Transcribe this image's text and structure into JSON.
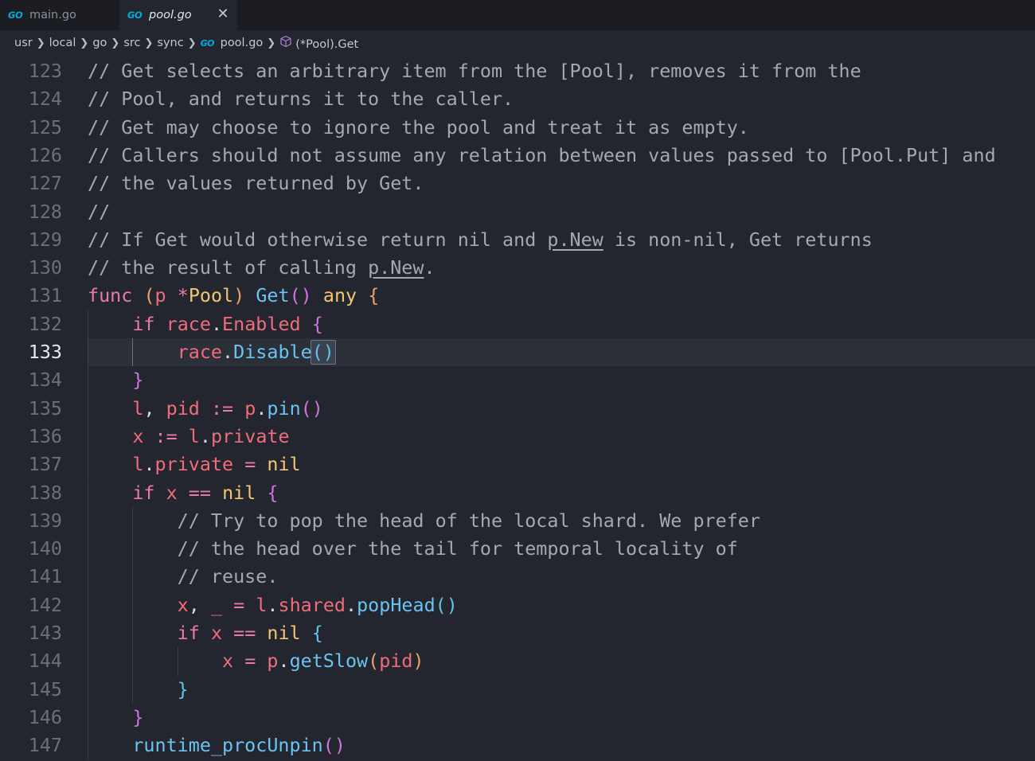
{
  "tabs": [
    {
      "label": "main.go",
      "icon": "go-file-icon",
      "active": false
    },
    {
      "label": "pool.go",
      "icon": "go-file-icon",
      "active": true
    }
  ],
  "tab_icon_text": "GO",
  "tab_close_glyph": "✕",
  "breadcrumb": [
    "usr",
    "local",
    "go",
    "src",
    "sync",
    "pool.go",
    "(*Pool).Get"
  ],
  "breadcrumb_separator": "❯",
  "current_line": 133,
  "colors": {
    "background": "#23262e",
    "tabbar": "#1b1d23",
    "comment": "#a3a8b2",
    "keyword": "#e87aa4",
    "function": "#6cc3f2",
    "variable": "#f06c7c",
    "type": "#f2c572"
  },
  "code_lines": [
    {
      "n": 123,
      "indent": 0,
      "tokens": [
        [
          "cm",
          "// Get selects an arbitrary item from the [Pool], removes it from the"
        ]
      ]
    },
    {
      "n": 124,
      "indent": 0,
      "tokens": [
        [
          "cm",
          "// Pool, and returns it to the caller."
        ]
      ]
    },
    {
      "n": 125,
      "indent": 0,
      "tokens": [
        [
          "cm",
          "// Get may choose to ignore the pool and treat it as empty."
        ]
      ]
    },
    {
      "n": 126,
      "indent": 0,
      "tokens": [
        [
          "cm",
          "// Callers should not assume any relation between values passed to [Pool.Put] and"
        ]
      ]
    },
    {
      "n": 127,
      "indent": 0,
      "tokens": [
        [
          "cm",
          "// the values returned by Get."
        ]
      ]
    },
    {
      "n": 128,
      "indent": 0,
      "tokens": [
        [
          "cm",
          "//"
        ]
      ]
    },
    {
      "n": 129,
      "indent": 0,
      "tokens": [
        [
          "cm",
          "// If Get would otherwise return nil and "
        ],
        [
          "cm ul",
          "p.New"
        ],
        [
          "cm",
          " is non-nil, Get returns"
        ]
      ]
    },
    {
      "n": 130,
      "indent": 0,
      "tokens": [
        [
          "cm",
          "// the result of calling "
        ],
        [
          "cm ul",
          "p.New"
        ],
        [
          "cm",
          "."
        ]
      ]
    },
    {
      "n": 131,
      "indent": 0,
      "tokens": [
        [
          "kw",
          "func"
        ],
        [
          "ps",
          " "
        ],
        [
          "b1",
          "("
        ],
        [
          "vr",
          "p"
        ],
        [
          "ps",
          " "
        ],
        [
          "op",
          "*"
        ],
        [
          "ty",
          "Pool"
        ],
        [
          "b1",
          ")"
        ],
        [
          "ps",
          " "
        ],
        [
          "fn",
          "Get"
        ],
        [
          "b2",
          "()"
        ],
        [
          "ps",
          " "
        ],
        [
          "ty",
          "any"
        ],
        [
          "ps",
          " "
        ],
        [
          "b1",
          "{"
        ]
      ]
    },
    {
      "n": 132,
      "indent": 1,
      "tokens": [
        [
          "kw",
          "if"
        ],
        [
          "ps",
          " "
        ],
        [
          "vr",
          "race"
        ],
        [
          "ps",
          "."
        ],
        [
          "vr",
          "Enabled"
        ],
        [
          "ps",
          " "
        ],
        [
          "b2",
          "{"
        ]
      ]
    },
    {
      "n": 133,
      "indent": 2,
      "tokens": [
        [
          "vr",
          "race"
        ],
        [
          "ps",
          "."
        ],
        [
          "fn",
          "Disable"
        ],
        [
          "b3",
          "()"
        ]
      ]
    },
    {
      "n": 134,
      "indent": 1,
      "tokens": [
        [
          "b2",
          "}"
        ]
      ]
    },
    {
      "n": 135,
      "indent": 1,
      "tokens": [
        [
          "vr",
          "l"
        ],
        [
          "ps",
          ", "
        ],
        [
          "vr",
          "pid"
        ],
        [
          "ps",
          " "
        ],
        [
          "op",
          ":="
        ],
        [
          "ps",
          " "
        ],
        [
          "vr",
          "p"
        ],
        [
          "ps",
          "."
        ],
        [
          "fn",
          "pin"
        ],
        [
          "b2",
          "()"
        ]
      ]
    },
    {
      "n": 136,
      "indent": 1,
      "tokens": [
        [
          "vr",
          "x"
        ],
        [
          "ps",
          " "
        ],
        [
          "op",
          ":="
        ],
        [
          "ps",
          " "
        ],
        [
          "vr",
          "l"
        ],
        [
          "ps",
          "."
        ],
        [
          "vr",
          "private"
        ]
      ]
    },
    {
      "n": 137,
      "indent": 1,
      "tokens": [
        [
          "vr",
          "l"
        ],
        [
          "ps",
          "."
        ],
        [
          "vr",
          "private"
        ],
        [
          "ps",
          " "
        ],
        [
          "op",
          "="
        ],
        [
          "ps",
          " "
        ],
        [
          "nl",
          "nil"
        ]
      ]
    },
    {
      "n": 138,
      "indent": 1,
      "tokens": [
        [
          "kw",
          "if"
        ],
        [
          "ps",
          " "
        ],
        [
          "vr",
          "x"
        ],
        [
          "ps",
          " "
        ],
        [
          "op",
          "=="
        ],
        [
          "ps",
          " "
        ],
        [
          "nl",
          "nil"
        ],
        [
          "ps",
          " "
        ],
        [
          "b2",
          "{"
        ]
      ]
    },
    {
      "n": 139,
      "indent": 2,
      "tokens": [
        [
          "cm",
          "// Try to pop the head of the local shard. We prefer"
        ]
      ]
    },
    {
      "n": 140,
      "indent": 2,
      "tokens": [
        [
          "cm",
          "// the head over the tail for temporal locality of"
        ]
      ]
    },
    {
      "n": 141,
      "indent": 2,
      "tokens": [
        [
          "cm",
          "// reuse."
        ]
      ]
    },
    {
      "n": 142,
      "indent": 2,
      "tokens": [
        [
          "vr",
          "x"
        ],
        [
          "ps",
          ", "
        ],
        [
          "vr",
          "_"
        ],
        [
          "ps",
          " "
        ],
        [
          "op",
          "="
        ],
        [
          "ps",
          " "
        ],
        [
          "vr",
          "l"
        ],
        [
          "ps",
          "."
        ],
        [
          "vr",
          "shared"
        ],
        [
          "ps",
          "."
        ],
        [
          "fn",
          "popHead"
        ],
        [
          "b3",
          "()"
        ]
      ]
    },
    {
      "n": 143,
      "indent": 2,
      "tokens": [
        [
          "kw",
          "if"
        ],
        [
          "ps",
          " "
        ],
        [
          "vr",
          "x"
        ],
        [
          "ps",
          " "
        ],
        [
          "op",
          "=="
        ],
        [
          "ps",
          " "
        ],
        [
          "nl",
          "nil"
        ],
        [
          "ps",
          " "
        ],
        [
          "b3",
          "{"
        ]
      ]
    },
    {
      "n": 144,
      "indent": 3,
      "tokens": [
        [
          "vr",
          "x"
        ],
        [
          "ps",
          " "
        ],
        [
          "op",
          "="
        ],
        [
          "ps",
          " "
        ],
        [
          "vr",
          "p"
        ],
        [
          "ps",
          "."
        ],
        [
          "fn",
          "getSlow"
        ],
        [
          "b1",
          "("
        ],
        [
          "vr",
          "pid"
        ],
        [
          "b1",
          ")"
        ]
      ]
    },
    {
      "n": 145,
      "indent": 2,
      "tokens": [
        [
          "b3",
          "}"
        ]
      ]
    },
    {
      "n": 146,
      "indent": 1,
      "tokens": [
        [
          "b2",
          "}"
        ]
      ]
    },
    {
      "n": 147,
      "indent": 1,
      "tokens": [
        [
          "fn",
          "runtime_procUnpin"
        ],
        [
          "b2",
          "()"
        ]
      ]
    }
  ]
}
